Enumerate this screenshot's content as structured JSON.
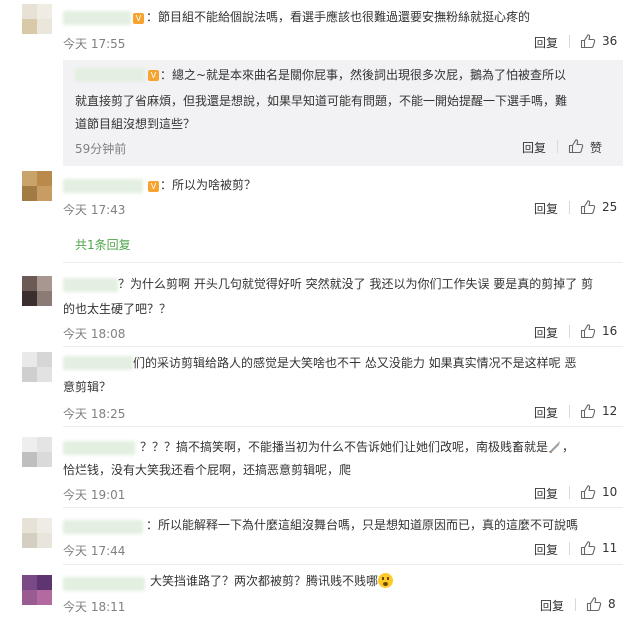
{
  "comments": [
    {
      "text": "：節目組不能給個說法嗎，看選手應該也很難過還要安撫粉絲就挺心疼的",
      "time": "今天 17:55",
      "reply": "回复",
      "likes": "36"
    },
    {
      "text": "：所以为啥被剪？",
      "time": "今天 17:43",
      "reply": "回复",
      "likes": "25"
    },
    {
      "text_line1": "？为什么剪啊 开头几句就觉得好听 突然就没了 我还以为你们工作失误 要是真的剪掉了 剪",
      "text_line2": "的也太生硬了吧？？",
      "time": "今天 18:08",
      "reply": "回复",
      "likes": "16"
    },
    {
      "text_line1": "们的采访剪辑给路人的感觉是大笑啥也不干 怂又没能力 如果真实情况不是这样呢 恶",
      "text_line2": "意剪辑？",
      "time": "今天 18:25",
      "reply": "回复",
      "likes": "12"
    },
    {
      "text_line1": "？？？搞不搞笑啊，不能播当初为什么不告诉她们让她们改呢，南极贱畜就是",
      "text_line1_end": "，",
      "text_line2": "恰烂钱，没有大笑我还看个屁啊，还搞恶意剪辑呢，爬",
      "time": "今天 19:01",
      "reply": "回复",
      "likes": "10"
    },
    {
      "text": "：所以能解释一下為什麼這組沒舞台嗎，只是想知道原因而已，真的這麼不可說嗎",
      "time": "今天 17:44",
      "reply": "回复",
      "likes": "11"
    },
    {
      "text": "大笑挡谁路了？两次都被剪？腾讯贱不贱哪",
      "time": "今天 18:11",
      "reply": "回复",
      "likes": "8"
    }
  ],
  "subreply": {
    "line1": "：總之~就是本來曲名是關你屁事，然後詞出現很多次屁，鵝為了怕被查所以",
    "line2": "就直接剪了省麻煩，但我還是想說，如果早知道可能有問題，不能一開始提醒一下選手嗎，難",
    "line3": "道節目組沒想到這些？",
    "time": "59分钟前",
    "reply": "回复",
    "like_label": "赞"
  },
  "more_replies": "共1条回复",
  "icons": {
    "like": "thumbs-up-icon",
    "vip": "vip-badge-icon",
    "emoji": "scared-face-emoji",
    "knife": "knife-emoji"
  },
  "colors": {
    "accent_green": "#4fa74d",
    "time_gray": "#808080",
    "subreply_bg": "#f2f2f5"
  }
}
